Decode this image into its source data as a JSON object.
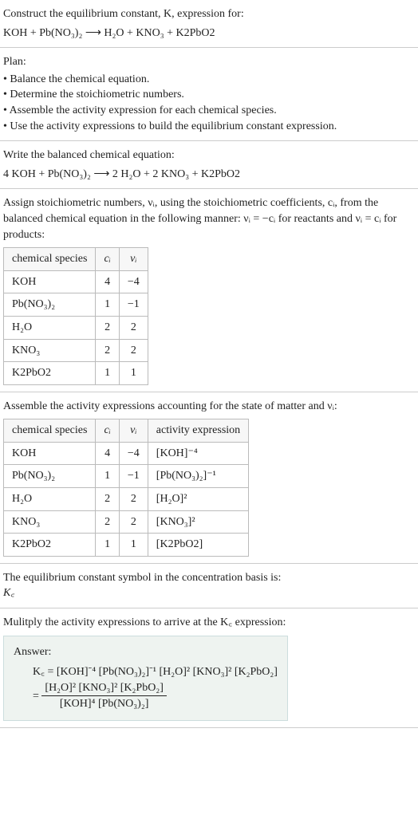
{
  "s1": {
    "line1": "Construct the equilibrium constant, K, expression for:",
    "eq": "KOH + Pb(NO₃)₂  ⟶  H₂O + KNO₃ + K2PbO2"
  },
  "s2": {
    "heading": "Plan:",
    "items": [
      "• Balance the chemical equation.",
      "• Determine the stoichiometric numbers.",
      "• Assemble the activity expression for each chemical species.",
      "• Use the activity expressions to build the equilibrium constant expression."
    ]
  },
  "s3": {
    "line1": "Write the balanced chemical equation:",
    "eq": "4 KOH + Pb(NO₃)₂  ⟶  2 H₂O + 2 KNO₃ + K2PbO2"
  },
  "s4": {
    "intro": "Assign stoichiometric numbers, νᵢ, using the stoichiometric coefficients, cᵢ, from the balanced chemical equation in the following manner: νᵢ = −cᵢ for reactants and νᵢ = cᵢ for products:",
    "headers": {
      "h1": "chemical species",
      "h2": "cᵢ",
      "h3": "νᵢ"
    },
    "rows": [
      {
        "sp": "KOH",
        "c": "4",
        "v": "−4"
      },
      {
        "sp": "Pb(NO₃)₂",
        "c": "1",
        "v": "−1"
      },
      {
        "sp": "H₂O",
        "c": "2",
        "v": "2"
      },
      {
        "sp": "KNO₃",
        "c": "2",
        "v": "2"
      },
      {
        "sp": "K2PbO2",
        "c": "1",
        "v": "1"
      }
    ]
  },
  "s5": {
    "intro": "Assemble the activity expressions accounting for the state of matter and νᵢ:",
    "headers": {
      "h1": "chemical species",
      "h2": "cᵢ",
      "h3": "νᵢ",
      "h4": "activity expression"
    },
    "rows": [
      {
        "sp": "KOH",
        "c": "4",
        "v": "−4",
        "ax": "[KOH]⁻⁴"
      },
      {
        "sp": "Pb(NO₃)₂",
        "c": "1",
        "v": "−1",
        "ax": "[Pb(NO₃)₂]⁻¹"
      },
      {
        "sp": "H₂O",
        "c": "2",
        "v": "2",
        "ax": "[H₂O]²"
      },
      {
        "sp": "KNO₃",
        "c": "2",
        "v": "2",
        "ax": "[KNO₃]²"
      },
      {
        "sp": "K2PbO2",
        "c": "1",
        "v": "1",
        "ax": "[K2PbO2]"
      }
    ]
  },
  "s6": {
    "line1": "The equilibrium constant symbol in the concentration basis is:",
    "sym": "K꜀"
  },
  "s7": {
    "line1": "Mulitply the activity expressions to arrive at the K꜀ expression:",
    "answer_label": "Answer:",
    "expr1": "K꜀ = [KOH]⁻⁴ [Pb(NO₃)₂]⁻¹ [H₂O]² [KNO₃]² [K₂PbO₂]",
    "frac_num": "[H₂O]² [KNO₃]² [K₂PbO₂]",
    "frac_den": "[KOH]⁴ [Pb(NO₃)₂]",
    "eq_prefix": "= "
  }
}
